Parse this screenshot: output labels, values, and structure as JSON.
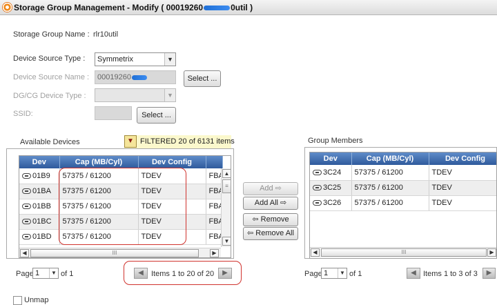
{
  "window": {
    "title_prefix": "Storage Group Management - Modify ( 00019260",
    "title_suffix": "0util )"
  },
  "form": {
    "sg_name_label": "Storage Group Name :",
    "sg_name_value": "rlr10util",
    "source_type_label": "Device Source Type :",
    "source_type_value": "Symmetrix",
    "source_name_label": "Device Source Name :",
    "source_name_value": "00019260",
    "select_label": "Select ...",
    "dgcg_label": "DG/CG Device Type :",
    "ssid_label": "SSID:",
    "ssid_select_label": "Select ..."
  },
  "available": {
    "title": "Available Devices",
    "filter_text": "FILTERED 20 of 6131 items",
    "columns": [
      "Dev",
      "Cap (MB/Cyl)",
      "Dev Config",
      ""
    ],
    "rows": [
      {
        "dev": "01B9",
        "cap": "57375 / 61200",
        "config": "TDEV",
        "extra": "FBA"
      },
      {
        "dev": "01BA",
        "cap": "57375 / 61200",
        "config": "TDEV",
        "extra": "FBA"
      },
      {
        "dev": "01BB",
        "cap": "57375 / 61200",
        "config": "TDEV",
        "extra": "FBA"
      },
      {
        "dev": "01BC",
        "cap": "57375 / 61200",
        "config": "TDEV",
        "extra": "FBA"
      },
      {
        "dev": "01BD",
        "cap": "57375 / 61200",
        "config": "TDEV",
        "extra": "FBA"
      }
    ],
    "page_label": "Page",
    "page_value": "1",
    "of_label": "of 1",
    "items_text": "Items 1 to 20 of 20"
  },
  "actions": {
    "add": "Add ⇨",
    "add_all": "Add All ⇨",
    "remove": "⇦ Remove",
    "remove_all": "⇦ Remove All"
  },
  "members": {
    "title": "Group Members",
    "columns": [
      "Dev",
      "Cap (MB/Cyl)",
      "Dev Config"
    ],
    "rows": [
      {
        "dev": "3C24",
        "cap": "57375 / 61200",
        "config": "TDEV"
      },
      {
        "dev": "3C25",
        "cap": "57375 / 61200",
        "config": "TDEV"
      },
      {
        "dev": "3C26",
        "cap": "57375 / 61200",
        "config": "TDEV"
      }
    ],
    "page_label": "Page",
    "page_value": "1",
    "of_label": "of 1",
    "items_text": "Items 1 to 3 of 3"
  },
  "footer": {
    "unmap_label": "Unmap"
  }
}
